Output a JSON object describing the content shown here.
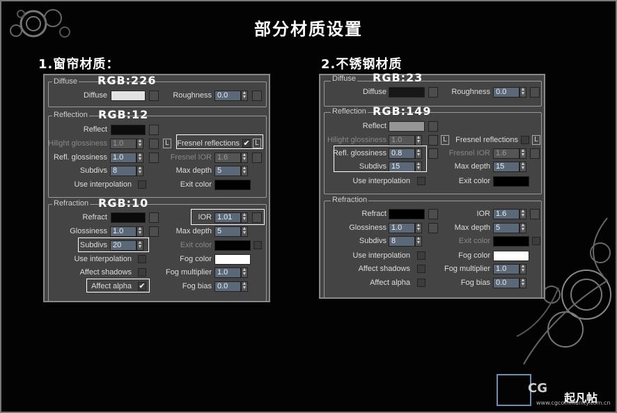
{
  "title": "部分材质设置",
  "sections": [
    {
      "heading": "1.窗帘材质："
    },
    {
      "heading": "2.不锈钢材质"
    }
  ],
  "labels": {
    "diffuse_group": "Diffuse",
    "diffuse": "Diffuse",
    "roughness": "Roughness",
    "reflection_group": "Reflection",
    "reflect": "Reflect",
    "hilight_glossiness": "Hilight glossiness",
    "lock": "L",
    "fresnel_reflections": "Fresnel reflections",
    "refl_glossiness": "Refl. glossiness",
    "fresnel_ior": "Fresnel IOR",
    "subdivs": "Subdivs",
    "max_depth": "Max depth",
    "use_interpolation": "Use interpolation",
    "exit_color": "Exit color",
    "refraction_group": "Refraction",
    "refract": "Refract",
    "ior": "IOR",
    "glossiness": "Glossiness",
    "fog_color": "Fog color",
    "affect_shadows": "Affect shadows",
    "fog_multiplier": "Fog multiplier",
    "affect_alpha": "Affect alpha",
    "fog_bias": "Fog bias"
  },
  "p1": {
    "ann_diffuse": "RGB:226",
    "ann_reflect": "RGB:12",
    "ann_refract": "RGB:10",
    "roughness": "0.0",
    "hilight_glossiness": "1.0",
    "fresnel_check": "✔",
    "refl_glossiness": "1.0",
    "fresnel_ior": "1.6",
    "refl_subdivs": "8",
    "refl_max_depth": "5",
    "ior": "1.01",
    "refr_glossiness": "1.0",
    "refr_max_depth": "5",
    "refr_subdivs": "20",
    "fog_multiplier": "1.0",
    "affect_alpha_check": "✔",
    "fog_bias": "0.0"
  },
  "p2": {
    "ann_diffuse": "RGB:23",
    "ann_reflect": "RGB:149",
    "roughness": "0.0",
    "hilight_glossiness": "1.0",
    "refl_glossiness": "0.8",
    "fresnel_ior": "1.6",
    "refl_subdivs": "15",
    "refl_max_depth": "15",
    "ior": "1.6",
    "refr_glossiness": "1.0",
    "refr_max_depth": "5",
    "refr_subdivs": "8",
    "fog_multiplier": "1.0",
    "fog_bias": "0.0"
  },
  "logo": {
    "cg": "CG",
    "name": "起凡帖",
    "url": "www.cgcommunity.com.cn"
  }
}
